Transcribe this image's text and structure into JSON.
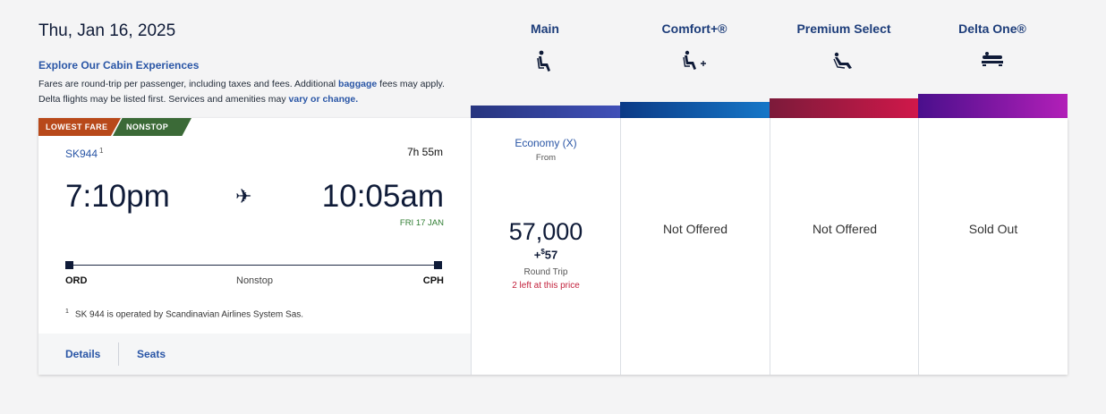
{
  "header": {
    "date": "Thu, Jan 16, 2025",
    "explore_link": "Explore Our Cabin Experiences",
    "disclaimer_pre": "Fares are round-trip per passenger, including taxes and fees. Additional ",
    "disclaimer_link1": "baggage",
    "disclaimer_mid": " fees may apply. Delta flights may be listed first. Services and amenities may ",
    "disclaimer_link2": "vary or change."
  },
  "cabins": [
    {
      "name": "Main",
      "icon": "main-seat-icon",
      "color_from": "#27357f",
      "color_to": "#4050b8"
    },
    {
      "name": "Comfort+®",
      "icon": "comfort-plus-seat-icon",
      "color_from": "#0b3a86",
      "color_to": "#1677c8"
    },
    {
      "name": "Premium Select",
      "icon": "premium-select-seat-icon",
      "color_from": "#7c1a3a",
      "color_to": "#d0184a"
    },
    {
      "name": "Delta One®",
      "icon": "delta-one-bed-icon",
      "color_from": "#4a0f8c",
      "color_to": "#b21fb8"
    }
  ],
  "flight": {
    "tags": [
      "LOWEST FARE",
      "NONSTOP"
    ],
    "number": "SK944",
    "footnote_marker": "1",
    "duration": "7h 55m",
    "depart_time": "7:10pm",
    "arrive_time": "10:05am",
    "arrive_day": "FRI 17 JAN",
    "origin": "ORD",
    "destination": "CPH",
    "stops": "Nonstop",
    "operated_note": "SK 944 is operated by Scandinavian Airlines System Sas.",
    "details_link": "Details",
    "seats_link": "Seats"
  },
  "fares": {
    "main": {
      "fare_name": "Economy (X)",
      "from": "From",
      "miles": "57,000",
      "tax_prefix": "+",
      "tax_currency": "$",
      "tax_amount": "57",
      "trip_type": "Round Trip",
      "availability": "2 left at this price"
    },
    "comfort": {
      "status": "Not Offered"
    },
    "premium": {
      "status": "Not Offered"
    },
    "delta_one": {
      "status": "Sold Out"
    }
  },
  "colors": {
    "brand_blue": "#2a56a6",
    "navy": "#0f1b38",
    "availability_red": "#c21f3a",
    "arrival_green": "#2f7d32"
  }
}
